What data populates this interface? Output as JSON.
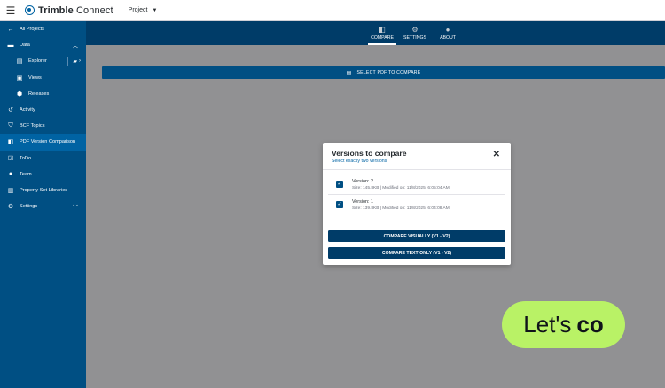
{
  "topbar": {
    "brand": "Trimble Connect",
    "project_label": "Project"
  },
  "sidebar": {
    "items": [
      {
        "label": "All Projects",
        "icon": "arrow-left-icon"
      },
      {
        "label": "Data",
        "icon": "folder-icon"
      },
      {
        "label": "Explorer",
        "icon": "folder-tree-icon"
      },
      {
        "label": "Views",
        "icon": "view-icon"
      },
      {
        "label": "Releases",
        "icon": "release-icon"
      },
      {
        "label": "Activity",
        "icon": "history-icon"
      },
      {
        "label": "BCF Topics",
        "icon": "shield-icon"
      },
      {
        "label": "PDF Version Comparison",
        "icon": "pdf-compare-icon"
      },
      {
        "label": "ToDo",
        "icon": "checkbox-icon"
      },
      {
        "label": "Team",
        "icon": "team-icon"
      },
      {
        "label": "Property Set Libraries",
        "icon": "library-icon"
      },
      {
        "label": "Settings",
        "icon": "gear-icon"
      }
    ]
  },
  "header": {
    "tabs": [
      {
        "label": "COMPARE",
        "icon": "compare-icon"
      },
      {
        "label": "SETTINGS",
        "icon": "gear-icon"
      },
      {
        "label": "ABOUT",
        "icon": "info-icon"
      }
    ]
  },
  "main": {
    "select_pdf_label": "SELECT PDF TO COMPARE"
  },
  "modal": {
    "title": "Versions to compare",
    "subtitle": "Select exactly two versions",
    "versions": [
      {
        "name": "Version: 2",
        "meta": "Size: 145.8KB | Modified on: 11/8/2025, 6:05:04 AM",
        "checked": true
      },
      {
        "name": "Version: 1",
        "meta": "Size: 139.8KB | Modified on: 11/8/2025, 6:04:08 AM",
        "checked": true
      }
    ],
    "compare_visually_label": "COMPARE VISUALLY (V1 - V2)",
    "compare_text_label": "COMPARE TEXT ONLY (V1 - V2)"
  },
  "bubble": {
    "text_regular": "Let's",
    "text_bold": "co"
  },
  "colors": {
    "sidebar_bg": "#004f83",
    "header_bg": "#003c68",
    "active_item": "#0063a3",
    "bubble_bg": "#b9f266",
    "overlay": "#919193"
  }
}
